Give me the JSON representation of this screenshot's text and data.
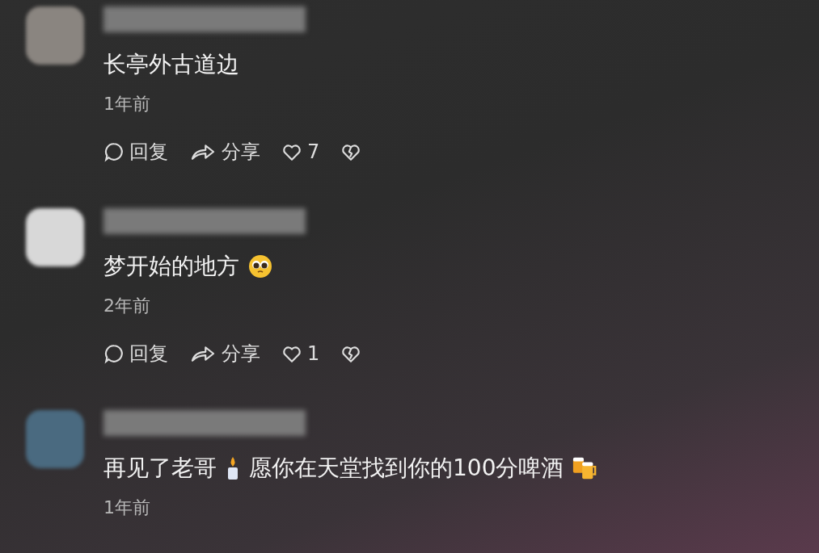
{
  "comments": [
    {
      "parts": [
        {
          "kind": "text",
          "text": "长亭外古道边"
        }
      ],
      "time": "1年前",
      "actions": {
        "reply": "回复",
        "share": "分享",
        "likes": "7"
      }
    },
    {
      "parts": [
        {
          "kind": "text",
          "text": "梦开始的地方"
        },
        {
          "kind": "pleading"
        }
      ],
      "time": "2年前",
      "actions": {
        "reply": "回复",
        "share": "分享",
        "likes": "1"
      }
    },
    {
      "parts": [
        {
          "kind": "text",
          "text": "再见了老哥"
        },
        {
          "kind": "candle"
        },
        {
          "kind": "text",
          "text": "愿你在天堂找到你的100分啤酒"
        },
        {
          "kind": "beers"
        }
      ],
      "time": "1年前"
    }
  ]
}
